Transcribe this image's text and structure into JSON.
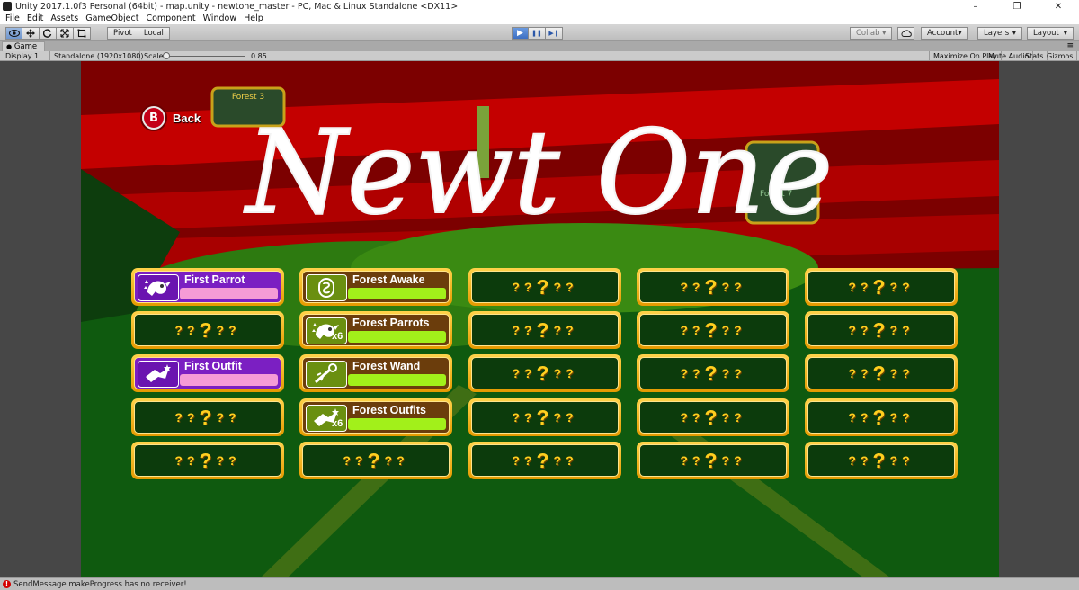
{
  "window": {
    "title": "Unity 2017.1.0f3 Personal (64bit) - map.unity - newtone_master - PC, Mac & Linux Standalone <DX11>",
    "minimize": "–",
    "restore": "❐",
    "close": "✕"
  },
  "menu": [
    "File",
    "Edit",
    "Assets",
    "GameObject",
    "Component",
    "Window",
    "Help"
  ],
  "toolbar": {
    "pivot": "Pivot",
    "local": "Local",
    "collab": "Collab ▾",
    "account": "Account",
    "layers": "Layers",
    "layout": "Layout",
    "dropdown_arrow": "▾",
    "play_icon": "▶",
    "pause_icon": "❚❚",
    "step_icon": "▶❙"
  },
  "game_tab": {
    "label": "Game",
    "display": "Display 1",
    "resolution": "Standalone (1920x1080)",
    "scale_label": "Scale",
    "scale_value": "0.85",
    "maximize": "Maximize On Play",
    "mute": "Mute Audio",
    "stats": "Stats",
    "gizmos": "Gizmos",
    "menu_dots": "≡"
  },
  "game": {
    "back_label": "Back",
    "back_glyph": "B",
    "logo_text": "Newt One",
    "achievements": [
      {
        "col": 0,
        "row": 0,
        "unlocked": true,
        "theme": "purple",
        "name": "First Parrot",
        "icon": "parrot-icon",
        "mult": ""
      },
      {
        "col": 0,
        "row": 1,
        "unlocked": false
      },
      {
        "col": 0,
        "row": 2,
        "unlocked": true,
        "theme": "purple",
        "name": "First Outfit",
        "icon": "outfit-icon",
        "mult": ""
      },
      {
        "col": 0,
        "row": 3,
        "unlocked": false
      },
      {
        "col": 0,
        "row": 4,
        "unlocked": false
      },
      {
        "col": 1,
        "row": 0,
        "unlocked": true,
        "theme": "brown",
        "name": "Forest Awake",
        "icon": "forest-seal-icon",
        "mult": ""
      },
      {
        "col": 1,
        "row": 1,
        "unlocked": true,
        "theme": "brown",
        "name": "Forest Parrots",
        "icon": "parrot-icon",
        "mult": "x6"
      },
      {
        "col": 1,
        "row": 2,
        "unlocked": true,
        "theme": "brown",
        "name": "Forest Wand",
        "icon": "wand-icon",
        "mult": ""
      },
      {
        "col": 1,
        "row": 3,
        "unlocked": true,
        "theme": "brown",
        "name": "Forest Outfits",
        "icon": "outfit-icon",
        "mult": "x6"
      },
      {
        "col": 1,
        "row": 4,
        "unlocked": false
      },
      {
        "col": 2,
        "row": 0,
        "unlocked": false
      },
      {
        "col": 2,
        "row": 1,
        "unlocked": false
      },
      {
        "col": 2,
        "row": 2,
        "unlocked": false
      },
      {
        "col": 2,
        "row": 3,
        "unlocked": false
      },
      {
        "col": 2,
        "row": 4,
        "unlocked": false
      },
      {
        "col": 3,
        "row": 0,
        "unlocked": false
      },
      {
        "col": 3,
        "row": 1,
        "unlocked": false
      },
      {
        "col": 3,
        "row": 2,
        "unlocked": false
      },
      {
        "col": 3,
        "row": 3,
        "unlocked": false
      },
      {
        "col": 3,
        "row": 4,
        "unlocked": false
      },
      {
        "col": 4,
        "row": 0,
        "unlocked": false
      },
      {
        "col": 4,
        "row": 1,
        "unlocked": false
      },
      {
        "col": 4,
        "row": 2,
        "unlocked": false
      },
      {
        "col": 4,
        "row": 3,
        "unlocked": false
      },
      {
        "col": 4,
        "row": 4,
        "unlocked": false
      }
    ],
    "locked_glyph": "?",
    "scene_signs": [
      "Forest 3",
      "Forest 7"
    ]
  },
  "status": {
    "error_icon": "!",
    "message": "SendMessage makeProgress has no receiver!"
  },
  "colors": {
    "scene_red": "#8a0000",
    "scene_green": "#0f5a0f",
    "card_gold": "#ffc21f",
    "purple": "#7b1fc2",
    "pink_bar": "#f59bd6",
    "lime_bar": "#a2f01a"
  }
}
